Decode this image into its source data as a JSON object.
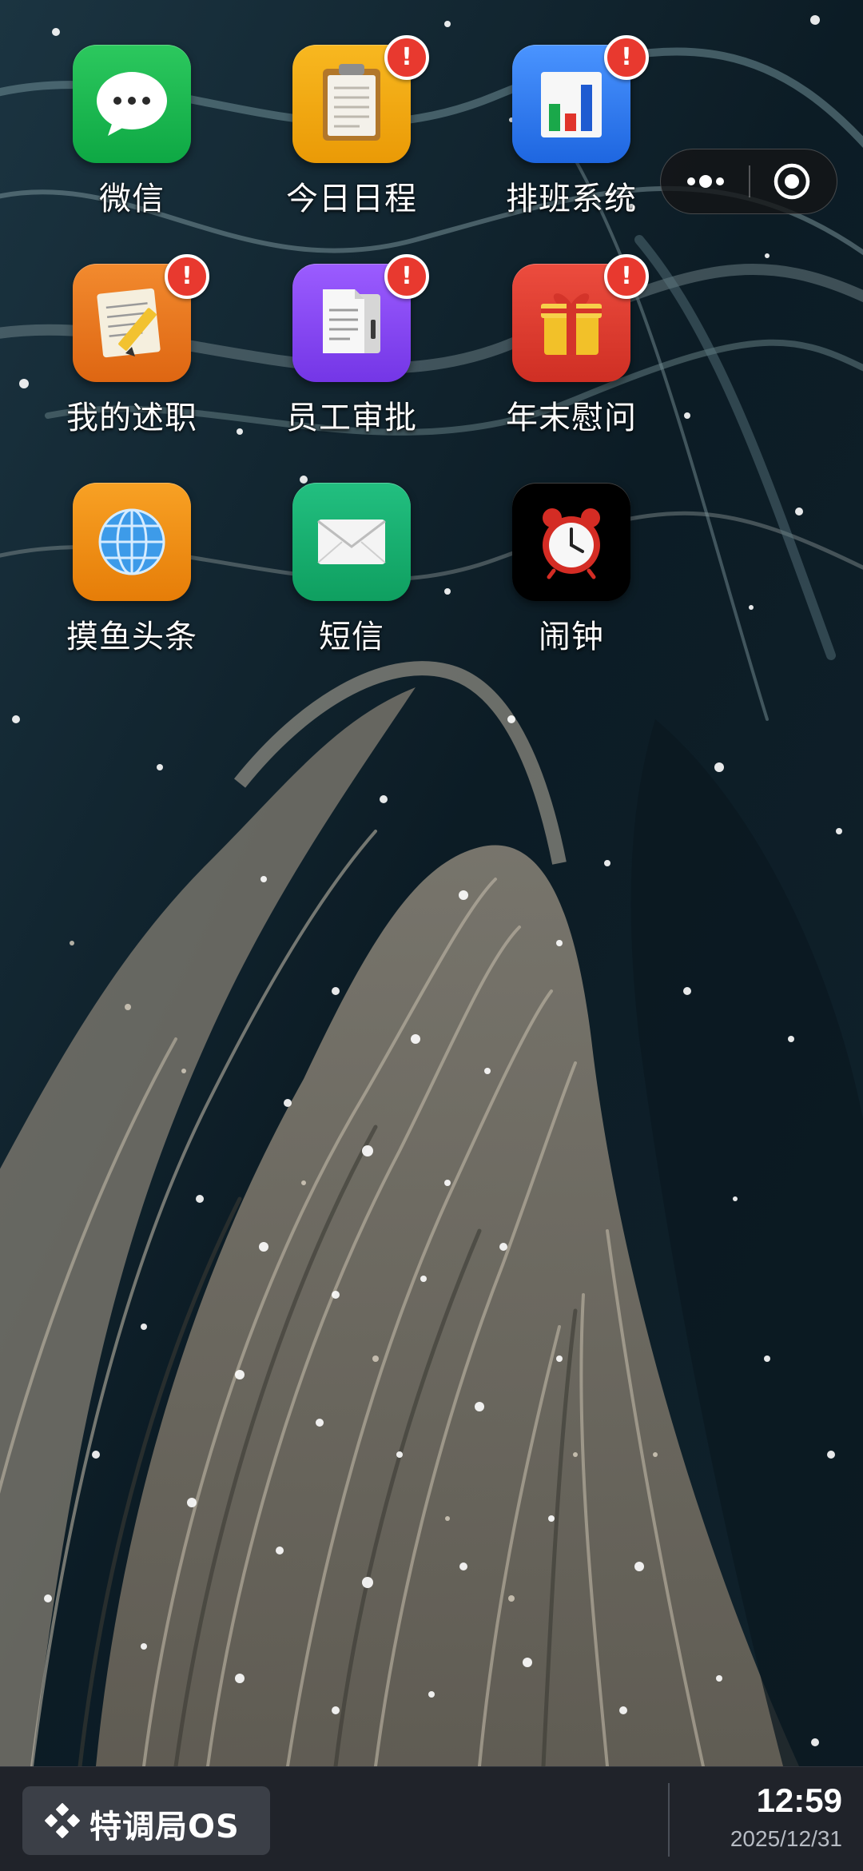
{
  "home": {
    "apps": [
      {
        "label": "微信",
        "icon": "wechat-icon",
        "badge": null,
        "color": "#14b44a"
      },
      {
        "label": "今日日程",
        "icon": "clipboard-icon",
        "badge": "!",
        "color": "#f2a411"
      },
      {
        "label": "排班系统",
        "icon": "bar-chart-icon",
        "badge": "!",
        "color": "#2d7cf0"
      },
      {
        "label": "我的述职",
        "icon": "notepad-pencil-icon",
        "badge": "!",
        "color": "#e8781c"
      },
      {
        "label": "员工审批",
        "icon": "documents-icon",
        "badge": "!",
        "color": "#8a4cf0"
      },
      {
        "label": "年末慰问",
        "icon": "gift-icon",
        "badge": "!",
        "color": "#e03a2e"
      },
      {
        "label": "摸鱼头条",
        "icon": "globe-icon",
        "badge": null,
        "color": "#f08a12"
      },
      {
        "label": "短信",
        "icon": "envelope-icon",
        "badge": null,
        "color": "#18b070"
      },
      {
        "label": "闹钟",
        "icon": "alarm-clock-icon",
        "badge": null,
        "color": "#000000"
      }
    ]
  },
  "capsule": {
    "more_icon": "more-dots-icon",
    "close_icon": "target-circle-icon"
  },
  "taskbar": {
    "start_label": "特调局OS",
    "start_icon": "diamond-dots-icon",
    "time": "12:59",
    "date": "2025/12/31"
  },
  "theme": {
    "taskbar_bg": "#20232a",
    "badge_red": "#e8392f",
    "wallpaper_dark": "#0d1e27"
  }
}
